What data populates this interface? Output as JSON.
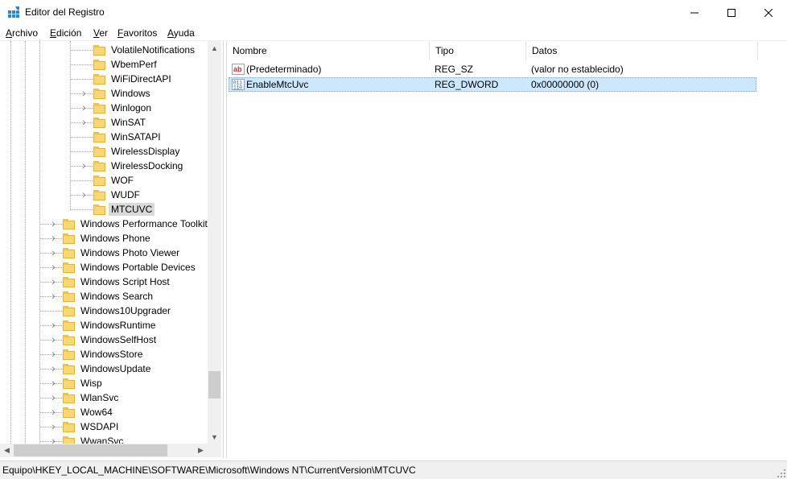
{
  "window": {
    "title": "Editor del Registro"
  },
  "menu": [
    {
      "label": "Archivo",
      "mnemonic": "A",
      "rest": "rchivo"
    },
    {
      "label": "Edición",
      "mnemonic": "E",
      "rest": "dición"
    },
    {
      "label": "Ver",
      "mnemonic": "V",
      "rest": "er"
    },
    {
      "label": "Favoritos",
      "mnemonic": "F",
      "rest": "avoritos"
    },
    {
      "label": "Ayuda",
      "mnemonic": "A",
      "rest": "yuda"
    }
  ],
  "tree": {
    "items": [
      {
        "label": "VolatileNotifications",
        "expandable": false,
        "level": 2
      },
      {
        "label": "WbemPerf",
        "expandable": false,
        "level": 2
      },
      {
        "label": "WiFiDirectAPI",
        "expandable": false,
        "level": 2
      },
      {
        "label": "Windows",
        "expandable": true,
        "level": 2
      },
      {
        "label": "Winlogon",
        "expandable": true,
        "level": 2
      },
      {
        "label": "WinSAT",
        "expandable": true,
        "level": 2
      },
      {
        "label": "WinSATAPI",
        "expandable": false,
        "level": 2
      },
      {
        "label": "WirelessDisplay",
        "expandable": false,
        "level": 2
      },
      {
        "label": "WirelessDocking",
        "expandable": true,
        "level": 2
      },
      {
        "label": "WOF",
        "expandable": false,
        "level": 2
      },
      {
        "label": "WUDF",
        "expandable": true,
        "level": 2
      },
      {
        "label": "MTCUVC",
        "expandable": false,
        "level": 2,
        "selected": true
      },
      {
        "label": "Windows Performance Toolkit",
        "expandable": true,
        "level": 1
      },
      {
        "label": "Windows Phone",
        "expandable": true,
        "level": 1
      },
      {
        "label": "Windows Photo Viewer",
        "expandable": true,
        "level": 1
      },
      {
        "label": "Windows Portable Devices",
        "expandable": true,
        "level": 1
      },
      {
        "label": "Windows Script Host",
        "expandable": true,
        "level": 1
      },
      {
        "label": "Windows Search",
        "expandable": true,
        "level": 1
      },
      {
        "label": "Windows10Upgrader",
        "expandable": false,
        "level": 1
      },
      {
        "label": "WindowsRuntime",
        "expandable": true,
        "level": 1
      },
      {
        "label": "WindowsSelfHost",
        "expandable": true,
        "level": 1
      },
      {
        "label": "WindowsStore",
        "expandable": true,
        "level": 1
      },
      {
        "label": "WindowsUpdate",
        "expandable": true,
        "level": 1
      },
      {
        "label": "Wisp",
        "expandable": true,
        "level": 1
      },
      {
        "label": "WlanSvc",
        "expandable": true,
        "level": 1
      },
      {
        "label": "Wow64",
        "expandable": true,
        "level": 1
      },
      {
        "label": "WSDAPI",
        "expandable": true,
        "level": 1
      },
      {
        "label": "WwanSvc",
        "expandable": true,
        "level": 1
      }
    ]
  },
  "list": {
    "columns": [
      "Nombre",
      "Tipo",
      "Datos"
    ],
    "rows": [
      {
        "icon": "string-value-icon",
        "name": "(Predeterminado)",
        "type": "REG_SZ",
        "data": "(valor no establecido)",
        "selected": false
      },
      {
        "icon": "binary-value-icon",
        "name": "EnableMtcUvc",
        "type": "REG_DWORD",
        "data": "0x00000000 (0)",
        "selected": true
      }
    ]
  },
  "status": {
    "path": "Equipo\\HKEY_LOCAL_MACHINE\\SOFTWARE\\Microsoft\\Windows NT\\CurrentVersion\\MTCUVC"
  },
  "colors": {
    "selection": "#cce8ff",
    "folder": "#f8d775",
    "tree_selection": "#d9d9d9"
  }
}
